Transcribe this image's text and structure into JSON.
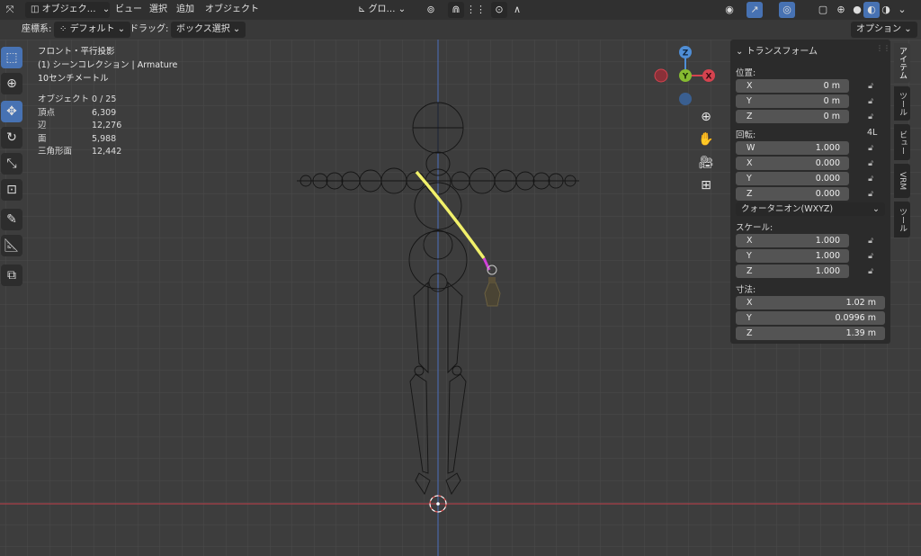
{
  "header": {
    "mode_label": "オブジェク…",
    "menus": [
      "ビュー",
      "選択",
      "追加",
      "オブジェクト"
    ],
    "transform_orientation": "グロ…"
  },
  "toolbar2": {
    "coord_label": "座標系:",
    "coord_value": "デフォルト",
    "drag_label": "ドラッグ:",
    "drag_value": "ボックス選択",
    "options_label": "オプション"
  },
  "viewport": {
    "view_name": "フロント・平行投影",
    "collection": "(1) シーンコレクション | Armature",
    "grid_scale": "10センチメートル",
    "stats": [
      {
        "label": "オブジェクト",
        "value": "0 / 25"
      },
      {
        "label": "頂点",
        "value": "6,309"
      },
      {
        "label": "辺",
        "value": "12,276"
      },
      {
        "label": "面",
        "value": "5,988"
      },
      {
        "label": "三角形面",
        "value": "12,442"
      }
    ],
    "gizmo": {
      "z": "Z",
      "y": "Y",
      "x": "X"
    }
  },
  "npanel": {
    "title": "トランスフォーム",
    "location_label": "位置:",
    "location": [
      {
        "axis": "X",
        "value": "0 m"
      },
      {
        "axis": "Y",
        "value": "0 m"
      },
      {
        "axis": "Z",
        "value": "0 m"
      }
    ],
    "rotation_label": "回転:",
    "rotation_mode_short": "4L",
    "rotation": [
      {
        "axis": "W",
        "value": "1.000"
      },
      {
        "axis": "X",
        "value": "0.000"
      },
      {
        "axis": "Y",
        "value": "0.000"
      },
      {
        "axis": "Z",
        "value": "0.000"
      }
    ],
    "rotation_mode": "クォータニオン(WXYZ)",
    "scale_label": "スケール:",
    "scale": [
      {
        "axis": "X",
        "value": "1.000"
      },
      {
        "axis": "Y",
        "value": "1.000"
      },
      {
        "axis": "Z",
        "value": "1.000"
      }
    ],
    "dimensions_label": "寸法:",
    "dimensions": [
      {
        "axis": "X",
        "value": "1.02 m"
      },
      {
        "axis": "Y",
        "value": "0.0996 m"
      },
      {
        "axis": "Z",
        "value": "1.39 m"
      }
    ]
  },
  "tabs": [
    "アイテム",
    "ツール",
    "ビュー",
    "VRM",
    "ツール"
  ],
  "colors": {
    "accent": "#4772b3",
    "x_axis": "#d5434f",
    "y_axis": "#86bb31",
    "z_axis": "#4f8ed6",
    "highlight": "#f1f06a"
  }
}
